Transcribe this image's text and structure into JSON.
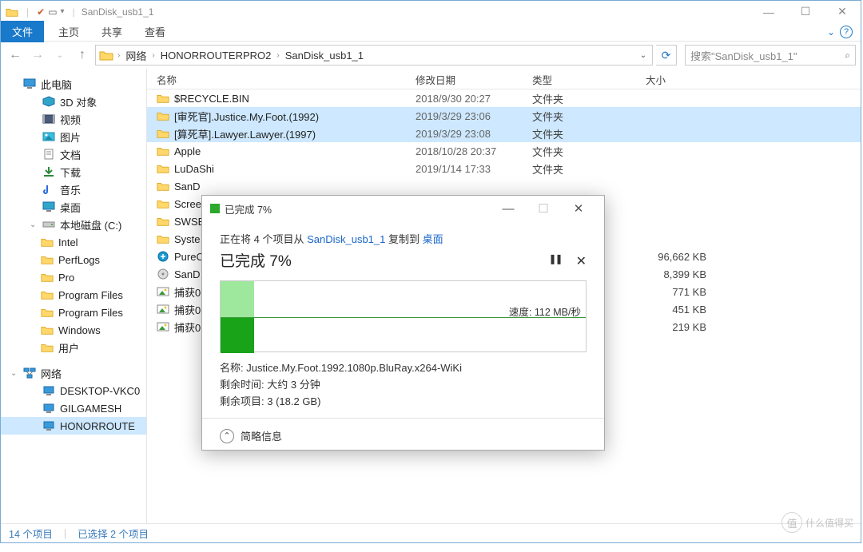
{
  "titlebar": {
    "title": "SanDisk_usb1_1"
  },
  "wincontrols": {
    "min": "—",
    "max": "☐",
    "close": "✕"
  },
  "ribbon": {
    "file": "文件",
    "home": "主页",
    "share": "共享",
    "view": "查看",
    "expand": "⌄",
    "help": "?"
  },
  "nav": {
    "back": "←",
    "forward": "→",
    "recent": "⌄",
    "up": "↑"
  },
  "breadcrumb": [
    "网络",
    "HONORROUTERPRO2",
    "SanDisk_usb1_1"
  ],
  "refresh": "⟳",
  "search": {
    "placeholder": "搜索\"SanDisk_usb1_1\"",
    "icon": "🔍"
  },
  "columns": {
    "name": "名称",
    "date": "修改日期",
    "type": "类型",
    "size": "大小"
  },
  "sidebar": [
    {
      "level": 1,
      "icon": "pc",
      "label": "此电脑"
    },
    {
      "level": 2,
      "icon": "3d",
      "label": "3D 对象"
    },
    {
      "level": 2,
      "icon": "video",
      "label": "视频"
    },
    {
      "level": 2,
      "icon": "pictures",
      "label": "图片"
    },
    {
      "level": 2,
      "icon": "documents",
      "label": "文档"
    },
    {
      "level": 2,
      "icon": "downloads",
      "label": "下载"
    },
    {
      "level": 2,
      "icon": "music",
      "label": "音乐"
    },
    {
      "level": 2,
      "icon": "desktop",
      "label": "桌面"
    },
    {
      "level": 2,
      "icon": "drive",
      "label": "本地磁盘 (C:)",
      "exp": true
    },
    {
      "level": 3,
      "icon": "folder",
      "label": "Intel"
    },
    {
      "level": 3,
      "icon": "folder",
      "label": "PerfLogs"
    },
    {
      "level": 3,
      "icon": "folder",
      "label": "Pro"
    },
    {
      "level": 3,
      "icon": "folder",
      "label": "Program Files"
    },
    {
      "level": 3,
      "icon": "folder",
      "label": "Program Files"
    },
    {
      "level": 3,
      "icon": "folder",
      "label": "Windows"
    },
    {
      "level": 3,
      "icon": "folder",
      "label": "用户"
    },
    {
      "level": 1,
      "icon": "network",
      "label": "网络",
      "exp": true
    },
    {
      "level": 2,
      "icon": "computer",
      "label": "DESKTOP-VKC0"
    },
    {
      "level": 2,
      "icon": "computer",
      "label": "GILGAMESH"
    },
    {
      "level": 2,
      "icon": "computer",
      "label": "HONORROUTE",
      "sel": true
    }
  ],
  "files": [
    {
      "icon": "folder",
      "name": "$RECYCLE.BIN",
      "date": "2018/9/30 20:27",
      "type": "文件夹",
      "size": ""
    },
    {
      "icon": "folder",
      "name": "[审死官].Justice.My.Foot.(1992)",
      "date": "2019/3/29 23:06",
      "type": "文件夹",
      "size": "",
      "sel": true
    },
    {
      "icon": "folder",
      "name": "[算死草].Lawyer.Lawyer.(1997)",
      "date": "2019/3/29 23:08",
      "type": "文件夹",
      "size": "",
      "sel": true
    },
    {
      "icon": "folder",
      "name": "Apple",
      "date": "2018/10/28 20:37",
      "type": "文件夹",
      "size": ""
    },
    {
      "icon": "folder",
      "name": "LuDaShi",
      "date": "2019/1/14 17:33",
      "type": "文件夹",
      "size": ""
    },
    {
      "icon": "folder",
      "name": "SanD",
      "date": "",
      "type": "",
      "size": ""
    },
    {
      "icon": "folder",
      "name": "Scree",
      "date": "",
      "type": "",
      "size": ""
    },
    {
      "icon": "folder",
      "name": "SWSE",
      "date": "",
      "type": "",
      "size": ""
    },
    {
      "icon": "folder",
      "name": "Syste",
      "date": "",
      "type": "",
      "size": ""
    },
    {
      "icon": "exe",
      "name": "PureC",
      "date": "",
      "type": "",
      "size": "96,662 KB"
    },
    {
      "icon": "disk",
      "name": "SanD",
      "date": "",
      "type": "",
      "size": "8,399 KB"
    },
    {
      "icon": "image",
      "name": "捕获0",
      "date": "",
      "type": "",
      "size": "771 KB"
    },
    {
      "icon": "image",
      "name": "捕获0",
      "date": "",
      "type": "",
      "size": "451 KB"
    },
    {
      "icon": "image",
      "name": "捕获0",
      "date": "",
      "type": "",
      "size": "219 KB"
    }
  ],
  "statusbar": {
    "count": "14 个项目",
    "selected": "已选择 2 个项目"
  },
  "dialog": {
    "title": "已完成 7%",
    "desc_prefix": "正在将 4 个项目从 ",
    "desc_src": "SanDisk_usb1_1",
    "desc_mid": " 复制到 ",
    "desc_dst": "桌面",
    "big": "已完成 7%",
    "pause": "❚❚",
    "cancel": "✕",
    "speed": "速度: 112 MB/秒",
    "name_label": "名称:  ",
    "name_value": "Justice.My.Foot.1992.1080p.BluRay.x264-WiKi",
    "time_label": "剩余时间:  ",
    "time_value": "大约 3 分钟",
    "items_label": "剩余项目:  ",
    "items_value": "3 (18.2 GB)",
    "footer": "简略信息",
    "min": "—",
    "max": "☐",
    "close": "✕"
  },
  "watermark": "什么值得买"
}
